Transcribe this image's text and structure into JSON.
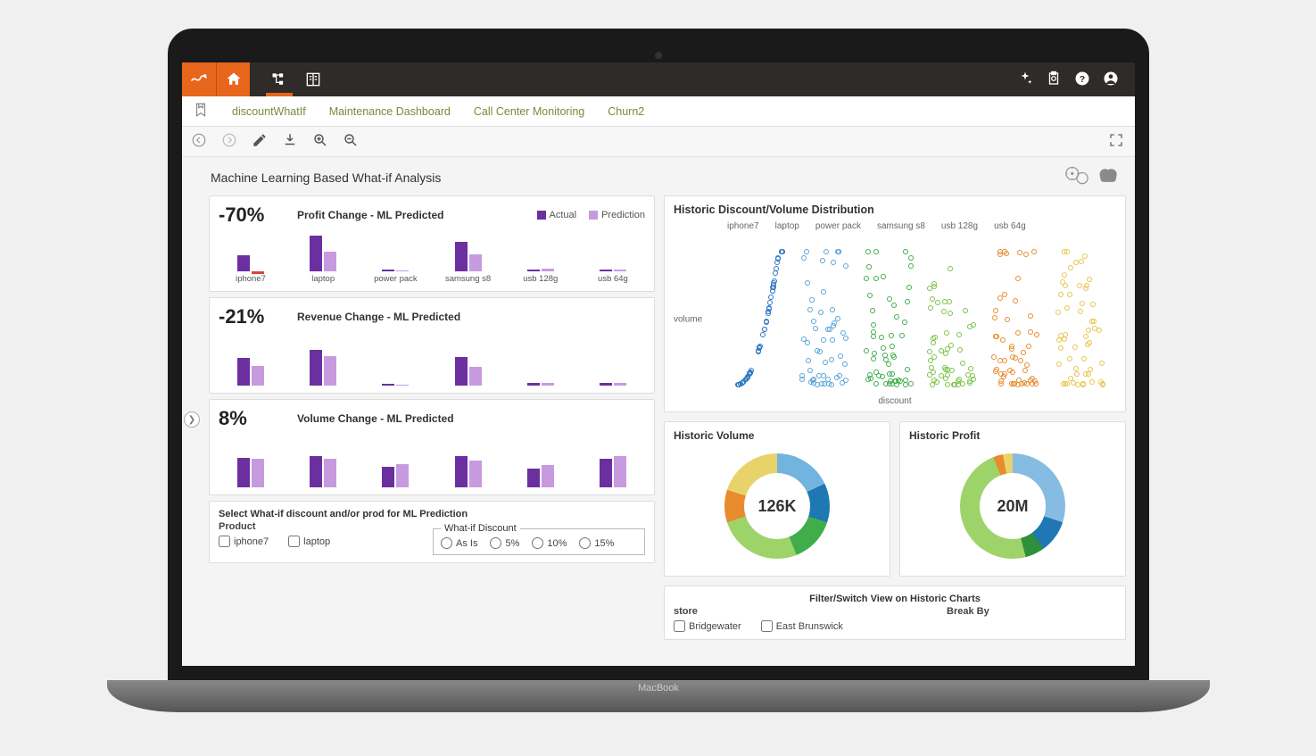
{
  "tabs": {
    "items": [
      "discountWhatIf",
      "Maintenance Dashboard",
      "Call Center Monitoring",
      "Churn2"
    ]
  },
  "page": {
    "title": "Machine Learning Based What-if Analysis"
  },
  "legend": {
    "actual": "Actual",
    "prediction": "Prediction"
  },
  "kpi_profit": {
    "value": "-70%",
    "title": "Profit Change - ML Predicted"
  },
  "kpi_revenue": {
    "value": "-21%",
    "title": "Revenue Change - ML Predicted"
  },
  "kpi_volume": {
    "value": "8%",
    "title": "Volume Change - ML Predicted"
  },
  "scatter": {
    "title": "Historic Discount/Volume Distribution",
    "ylabel": "volume",
    "xlabel": "discount",
    "categories": [
      "iphone7",
      "laptop",
      "power pack",
      "samsung s8",
      "usb 128g",
      "usb 64g"
    ],
    "colors": [
      "#2f78c4",
      "#5aa3d8",
      "#3fae4a",
      "#7cc34a",
      "#e88b2e",
      "#e6c64a"
    ]
  },
  "donuts": {
    "volume": {
      "title": "Historic Volume",
      "center": "126K",
      "slices": [
        {
          "color": "#72b4e0",
          "pct": 18
        },
        {
          "color": "#1f77b4",
          "pct": 12
        },
        {
          "color": "#3fae4a",
          "pct": 14
        },
        {
          "color": "#9ed36a",
          "pct": 26
        },
        {
          "color": "#e88b2e",
          "pct": 10
        },
        {
          "color": "#e8d36b",
          "pct": 20
        }
      ]
    },
    "profit": {
      "title": "Historic Profit",
      "center": "20M",
      "slices": [
        {
          "color": "#87bce2",
          "pct": 30
        },
        {
          "color": "#1f77b4",
          "pct": 10
        },
        {
          "color": "#2f8f3a",
          "pct": 6
        },
        {
          "color": "#9ed36a",
          "pct": 48
        },
        {
          "color": "#e88b2e",
          "pct": 3
        },
        {
          "color": "#e8d36b",
          "pct": 3
        }
      ]
    }
  },
  "select_panel": {
    "title": "Select What-if discount and/or prod for ML Prediction",
    "product_label": "Product",
    "products": [
      "iphone7",
      "laptop"
    ],
    "discount_label": "What-if Discount",
    "discounts": [
      "As Is",
      "5%",
      "10%",
      "15%"
    ]
  },
  "filter_panel": {
    "title": "Filter/Switch View on Historic Charts",
    "store_label": "store",
    "stores": [
      "Bridgewater",
      "East Brunswick"
    ],
    "break_label": "Break By"
  },
  "laptop_brand": "MacBook",
  "chart_data": [
    {
      "type": "bar",
      "title": "Profit Change - ML Predicted",
      "kpi": "-70%",
      "categories": [
        "iphone7",
        "laptop",
        "power pack",
        "samsung s8",
        "usb 128g",
        "usb 64g"
      ],
      "series": [
        {
          "name": "Actual",
          "values": [
            20,
            45,
            2,
            38,
            2,
            2
          ]
        },
        {
          "name": "Prediction",
          "values": [
            -6,
            25,
            1,
            22,
            3,
            2
          ]
        }
      ],
      "ylim": [
        -10,
        50
      ],
      "ylabel": "",
      "xlabel": ""
    },
    {
      "type": "bar",
      "title": "Revenue Change - ML Predicted",
      "kpi": "-21%",
      "categories": [
        "iphone7",
        "laptop",
        "power pack",
        "samsung s8",
        "usb 128g",
        "usb 64g"
      ],
      "series": [
        {
          "name": "Actual",
          "values": [
            42,
            55,
            3,
            44,
            4,
            4
          ]
        },
        {
          "name": "Prediction",
          "values": [
            30,
            45,
            2,
            28,
            4,
            4
          ]
        }
      ],
      "ylim": [
        0,
        60
      ],
      "ylabel": "",
      "xlabel": ""
    },
    {
      "type": "bar",
      "title": "Volume Change - ML Predicted",
      "kpi": "8%",
      "categories": [
        "iphone7",
        "laptop",
        "power pack",
        "samsung s8",
        "usb 128g",
        "usb 64g"
      ],
      "series": [
        {
          "name": "Actual",
          "values": [
            38,
            40,
            26,
            40,
            24,
            36
          ]
        },
        {
          "name": "Prediction",
          "values": [
            36,
            36,
            30,
            34,
            28,
            40
          ]
        }
      ],
      "ylim": [
        0,
        50
      ],
      "ylabel": "",
      "xlabel": ""
    },
    {
      "type": "scatter",
      "title": "Historic Discount/Volume Distribution",
      "xlabel": "discount",
      "ylabel": "volume",
      "series_names": [
        "iphone7",
        "laptop",
        "power pack",
        "samsung s8",
        "usb 128g",
        "usb 64g"
      ],
      "note": "dense jittered categorical scatter; exact points not labeled in source"
    },
    {
      "type": "pie",
      "title": "Historic Volume",
      "center_value": "126K",
      "slices": [
        {
          "label": "iphone7",
          "pct": 18
        },
        {
          "label": "laptop",
          "pct": 12
        },
        {
          "label": "power pack",
          "pct": 14
        },
        {
          "label": "samsung s8",
          "pct": 26
        },
        {
          "label": "usb 128g",
          "pct": 10
        },
        {
          "label": "usb 64g",
          "pct": 20
        }
      ]
    },
    {
      "type": "pie",
      "title": "Historic Profit",
      "center_value": "20M",
      "slices": [
        {
          "label": "iphone7",
          "pct": 30
        },
        {
          "label": "laptop",
          "pct": 10
        },
        {
          "label": "power pack",
          "pct": 6
        },
        {
          "label": "samsung s8",
          "pct": 48
        },
        {
          "label": "usb 128g",
          "pct": 3
        },
        {
          "label": "usb 64g",
          "pct": 3
        }
      ]
    }
  ]
}
